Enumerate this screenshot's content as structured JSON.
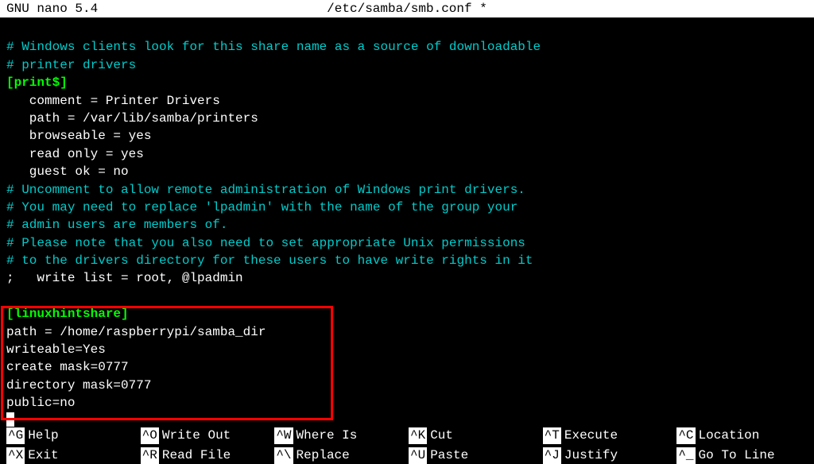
{
  "titlebar": {
    "app": "  GNU nano 5.4",
    "filepath": "/etc/samba/smb.conf *"
  },
  "lines": [
    {
      "text": "",
      "class": "normal"
    },
    {
      "text": "# Windows clients look for this share name as a source of downloadable",
      "class": "comment"
    },
    {
      "text": "# printer drivers",
      "class": "comment"
    },
    {
      "text": "[print$]",
      "class": "section"
    },
    {
      "text": "   comment = Printer Drivers",
      "class": "normal"
    },
    {
      "text": "   path = /var/lib/samba/printers",
      "class": "normal"
    },
    {
      "text": "   browseable = yes",
      "class": "normal"
    },
    {
      "text": "   read only = yes",
      "class": "normal"
    },
    {
      "text": "   guest ok = no",
      "class": "normal"
    },
    {
      "text": "# Uncomment to allow remote administration of Windows print drivers.",
      "class": "comment"
    },
    {
      "text": "# You may need to replace 'lpadmin' with the name of the group your",
      "class": "comment"
    },
    {
      "text": "# admin users are members of.",
      "class": "comment"
    },
    {
      "text": "# Please note that you also need to set appropriate Unix permissions",
      "class": "comment"
    },
    {
      "text": "# to the drivers directory for these users to have write rights in it",
      "class": "comment"
    },
    {
      "text": ";   write list = root, @lpadmin",
      "class": "normal"
    },
    {
      "text": "",
      "class": "normal"
    },
    {
      "text": "[linuxhintshare]",
      "class": "section"
    },
    {
      "text": "path = /home/raspberrypi/samba_dir",
      "class": "normal"
    },
    {
      "text": "writeable=Yes",
      "class": "normal"
    },
    {
      "text": "create mask=0777",
      "class": "normal"
    },
    {
      "text": "directory mask=0777",
      "class": "normal"
    },
    {
      "text": "public=no",
      "class": "normal"
    }
  ],
  "help": {
    "row1": [
      {
        "key": "^G",
        "label": "Help"
      },
      {
        "key": "^O",
        "label": "Write Out"
      },
      {
        "key": "^W",
        "label": "Where Is"
      },
      {
        "key": "^K",
        "label": "Cut"
      },
      {
        "key": "^T",
        "label": "Execute"
      },
      {
        "key": "^C",
        "label": "Location"
      }
    ],
    "row2": [
      {
        "key": "^X",
        "label": "Exit"
      },
      {
        "key": "^R",
        "label": "Read File"
      },
      {
        "key": "^\\",
        "label": "Replace"
      },
      {
        "key": "^U",
        "label": "Paste"
      },
      {
        "key": "^J",
        "label": "Justify"
      },
      {
        "key": "^_",
        "label": "Go To Line"
      }
    ]
  }
}
